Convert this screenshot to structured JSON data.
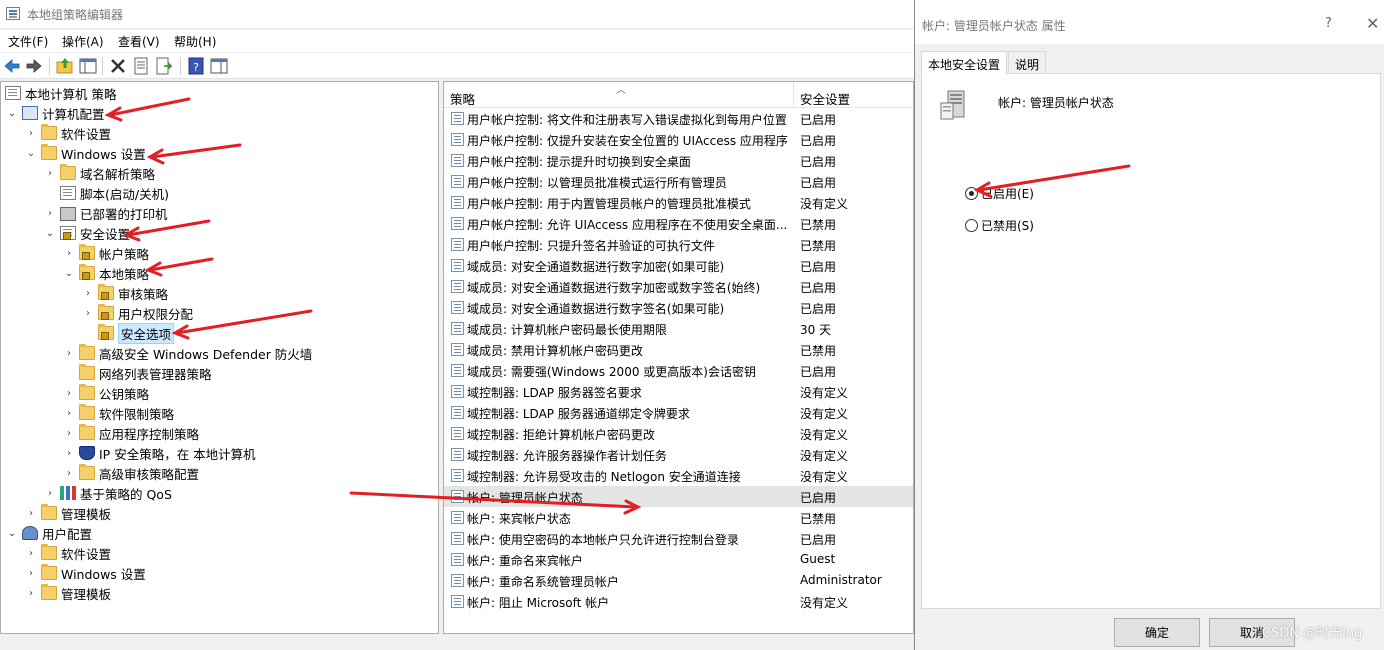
{
  "window": {
    "title": "本地组策略编辑器"
  },
  "menu": [
    "文件(F)",
    "操作(A)",
    "查看(V)",
    "帮助(H)"
  ],
  "toolbar_icons": [
    "back-icon",
    "forward-icon",
    "up-folder-icon",
    "show-hide-tree-icon",
    "delete-icon",
    "properties-icon",
    "export-list-icon",
    "help-icon",
    "action-pane-icon"
  ],
  "tree": {
    "root": "本地计算机 策略",
    "computer_config": "计算机配置",
    "software_settings": "软件设置",
    "windows_settings": "Windows 设置",
    "dns_policy": "域名解析策略",
    "scripts": "脚本(启动/关机)",
    "printers": "已部署的打印机",
    "security_settings": "安全设置",
    "account_policy": "帐户策略",
    "local_policy": "本地策略",
    "audit_policy": "审核策略",
    "user_rights": "用户权限分配",
    "security_options": "安全选项",
    "firewall": "高级安全 Windows Defender 防火墙",
    "network_list": "网络列表管理器策略",
    "public_key": "公钥策略",
    "software_restriction": "软件限制策略",
    "app_control": "应用程序控制策略",
    "ipsec": "IP 安全策略，在 本地计算机",
    "advanced_audit": "高级审核策略配置",
    "qos": "基于策略的 QoS",
    "admin_templates": "管理模板",
    "user_config": "用户配置",
    "user_software": "软件设置",
    "user_windows": "Windows 设置",
    "user_admin_templates": "管理模板"
  },
  "list": {
    "col_policy": "策略",
    "col_setting": "安全设置",
    "rows": [
      {
        "name": "用户帐户控制: 将文件和注册表写入错误虚拟化到每用户位置",
        "value": "已启用"
      },
      {
        "name": "用户帐户控制: 仅提升安装在安全位置的 UIAccess 应用程序",
        "value": "已启用"
      },
      {
        "name": "用户帐户控制: 提示提升时切换到安全桌面",
        "value": "已启用"
      },
      {
        "name": "用户帐户控制: 以管理员批准模式运行所有管理员",
        "value": "已启用"
      },
      {
        "name": "用户帐户控制: 用于内置管理员帐户的管理员批准模式",
        "value": "没有定义"
      },
      {
        "name": "用户帐户控制: 允许 UIAccess 应用程序在不使用安全桌面...",
        "value": "已禁用"
      },
      {
        "name": "用户帐户控制: 只提升签名并验证的可执行文件",
        "value": "已禁用"
      },
      {
        "name": "域成员: 对安全通道数据进行数字加密(如果可能)",
        "value": "已启用"
      },
      {
        "name": "域成员: 对安全通道数据进行数字加密或数字签名(始终)",
        "value": "已启用"
      },
      {
        "name": "域成员: 对安全通道数据进行数字签名(如果可能)",
        "value": "已启用"
      },
      {
        "name": "域成员: 计算机帐户密码最长使用期限",
        "value": "30 天"
      },
      {
        "name": "域成员: 禁用计算机帐户密码更改",
        "value": "已禁用"
      },
      {
        "name": "域成员: 需要强(Windows 2000 或更高版本)会话密钥",
        "value": "已启用"
      },
      {
        "name": "域控制器: LDAP 服务器签名要求",
        "value": "没有定义"
      },
      {
        "name": "域控制器: LDAP 服务器通道绑定令牌要求",
        "value": "没有定义"
      },
      {
        "name": "域控制器: 拒绝计算机帐户密码更改",
        "value": "没有定义"
      },
      {
        "name": "域控制器: 允许服务器操作者计划任务",
        "value": "没有定义"
      },
      {
        "name": "域控制器: 允许易受攻击的 Netlogon 安全通道连接",
        "value": "没有定义"
      },
      {
        "name": "帐户: 管理员帐户状态",
        "value": "已启用"
      },
      {
        "name": "帐户: 来宾帐户状态",
        "value": "已禁用"
      },
      {
        "name": "帐户: 使用空密码的本地帐户只允许进行控制台登录",
        "value": "已启用"
      },
      {
        "name": "帐户: 重命名来宾帐户",
        "value": "Guest"
      },
      {
        "name": "帐户: 重命名系统管理员帐户",
        "value": "Administrator"
      },
      {
        "name": "帐户: 阻止 Microsoft 帐户",
        "value": "没有定义"
      }
    ]
  },
  "dialog": {
    "title": "帐户: 管理员帐户状态 属性",
    "help": "?",
    "close": "✕",
    "tab_local": "本地安全设置",
    "tab_explain": "说明",
    "policy_name": "帐户: 管理员帐户状态",
    "radio_enabled": "已启用(E)",
    "radio_disabled": "已禁用(S)",
    "ok": "确定",
    "cancel": "取消"
  },
  "watermark": "CSDN @时光ing",
  "colors": {
    "annotation_arrow": "#e31e24",
    "selection": "#cce8ff",
    "row_highlight": "#e5e5e5"
  }
}
